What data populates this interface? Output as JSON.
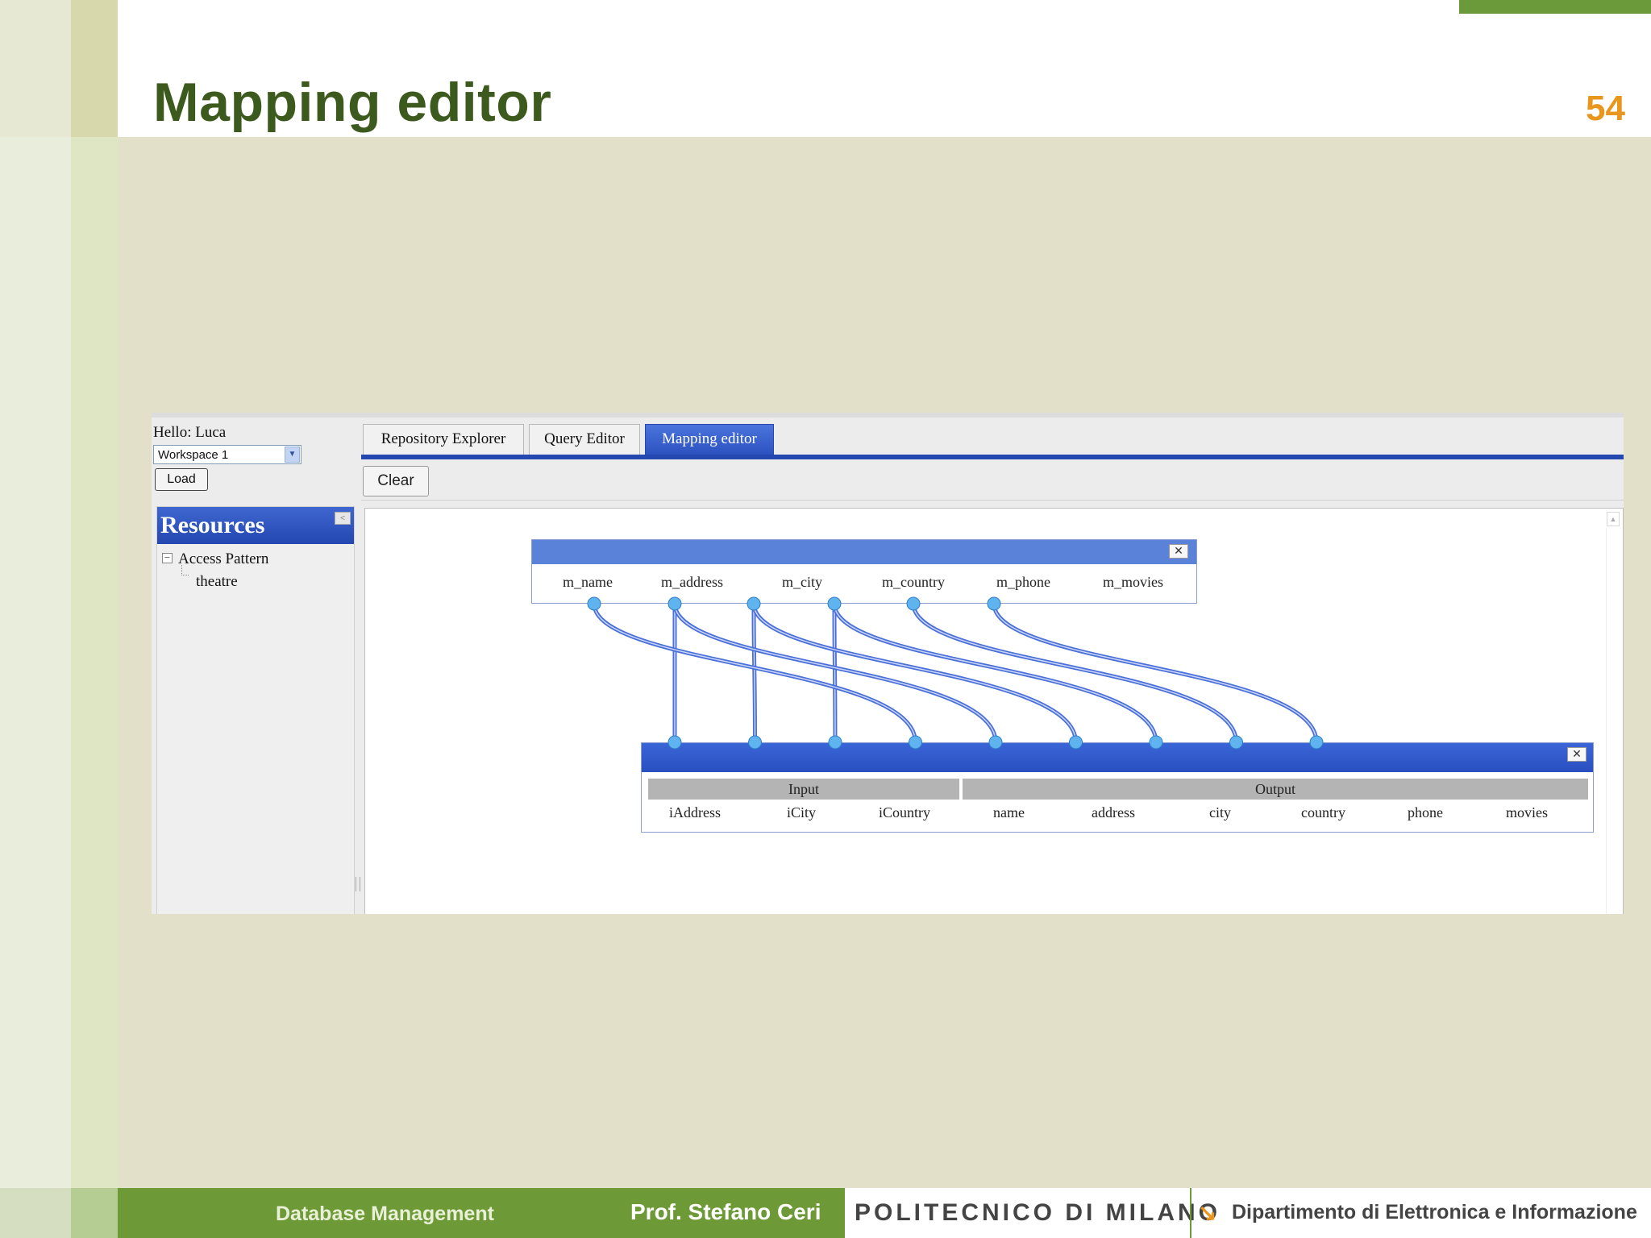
{
  "slide": {
    "title": "Mapping editor",
    "number": "54",
    "footer_course": "Database Management",
    "footer_prof": "Prof. Stefano Ceri",
    "brand_polimi": "POLITECNICO DI MILANO",
    "brand_dept": "Dipartimento di Elettronica e Informazione"
  },
  "app": {
    "greeting": "Hello: Luca",
    "workspace": "Workspace 1",
    "load_label": "Load",
    "sidebar": {
      "title": "Resources",
      "root": "Access Pattern",
      "child": "theatre"
    },
    "tabs": [
      {
        "label": "Repository Explorer",
        "active": false
      },
      {
        "label": "Query Editor",
        "active": false
      },
      {
        "label": "Mapping editor",
        "active": true
      }
    ],
    "clear_label": "Clear",
    "mapping": {
      "source_attributes": [
        "m_name",
        "m_address",
        "m_city",
        "m_country",
        "m_phone",
        "m_movies"
      ],
      "target": {
        "groups": [
          "Input",
          "Output"
        ],
        "input_columns": [
          "iAddress",
          "iCity",
          "iCountry"
        ],
        "output_columns": [
          "name",
          "address",
          "city",
          "country",
          "phone",
          "movies"
        ]
      },
      "links": [
        {
          "from": "m_address",
          "to": "iAddress"
        },
        {
          "from": "m_city",
          "to": "iCity"
        },
        {
          "from": "m_country",
          "to": "iCountry"
        },
        {
          "from": "m_name",
          "to": "name"
        },
        {
          "from": "m_address",
          "to": "address"
        },
        {
          "from": "m_city",
          "to": "city"
        },
        {
          "from": "m_country",
          "to": "country"
        },
        {
          "from": "m_phone",
          "to": "phone"
        },
        {
          "from": "m_movies",
          "to": "movies"
        }
      ],
      "link_color": "#4a6fd8",
      "port_color": "#5fb3ee"
    }
  }
}
